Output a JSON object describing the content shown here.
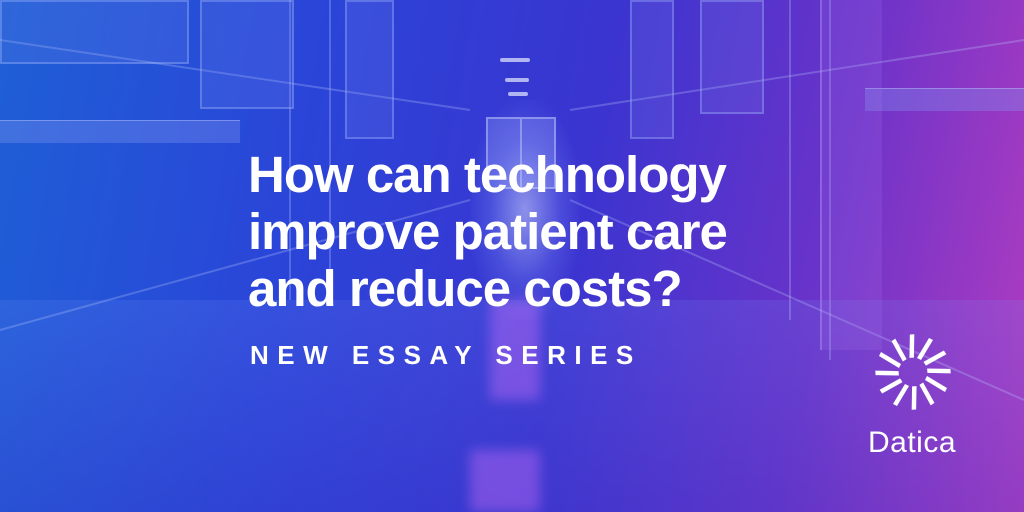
{
  "headline": {
    "line1": "How can technology",
    "line2": "improve patient care",
    "line3": "and reduce costs?"
  },
  "subtitle": "NEW ESSAY SERIES",
  "brand": {
    "name": "Datica",
    "logo_icon": "datica-radial-logo-icon"
  },
  "colors": {
    "gradient_left": "#1e5fd6",
    "gradient_mid": "#3a34d0",
    "gradient_right": "#b23cc0",
    "text": "#ffffff"
  }
}
